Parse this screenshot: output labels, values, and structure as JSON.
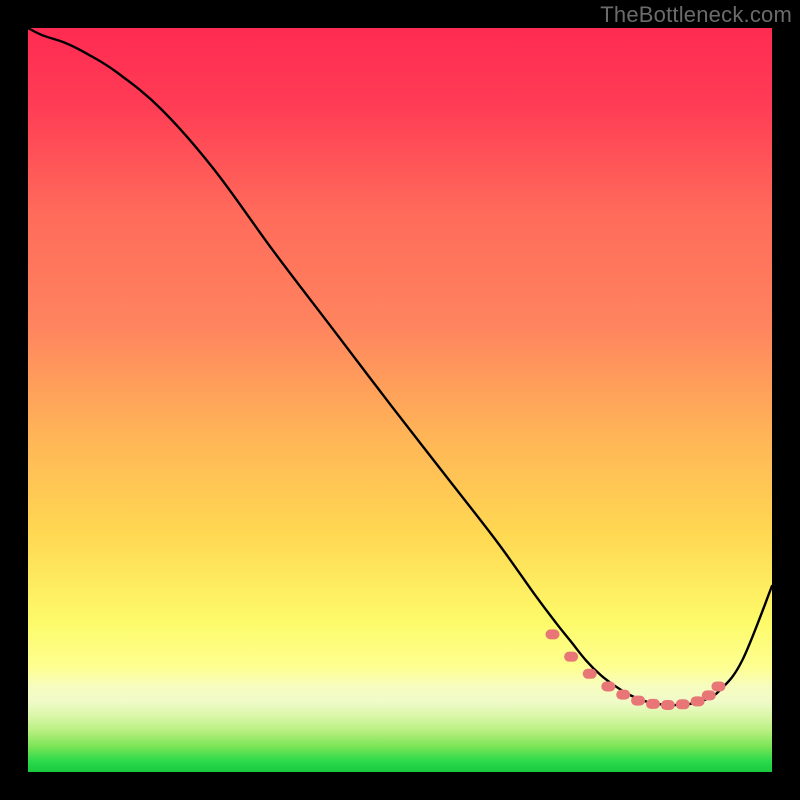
{
  "watermark": "TheBottleneck.com",
  "colors": {
    "frame": "#000000",
    "grad_top": "#ff2b52",
    "grad_mid1": "#ff845f",
    "grad_mid2": "#ffd852",
    "grad_mid3": "#fdfb6a",
    "grad_band": "#f7fcbf",
    "grad_green": "#2dda4b",
    "curve": "#000000",
    "marker": "#e97676"
  },
  "chart_data": {
    "type": "line",
    "title": "",
    "xlabel": "",
    "ylabel": "",
    "xlim": [
      0,
      100
    ],
    "ylim": [
      0,
      100
    ],
    "grid": false,
    "legend": false,
    "series": [
      {
        "name": "bottleneck-curve",
        "x": [
          0,
          2,
          5,
          8,
          12,
          18,
          25,
          33,
          41,
          49,
          56,
          63,
          68,
          71,
          73,
          75,
          77,
          79,
          81,
          83,
          85,
          87,
          89,
          91,
          93,
          96,
          100
        ],
        "y": [
          100,
          99,
          98,
          96.5,
          94,
          89,
          81,
          70,
          59.5,
          49,
          40,
          31,
          24,
          20,
          17.5,
          15,
          13,
          11.5,
          10.3,
          9.5,
          9.1,
          9.0,
          9.15,
          9.7,
          11,
          15,
          25
        ]
      }
    ],
    "markers": {
      "name": "highlight-dots",
      "x": [
        70.5,
        73,
        75.5,
        78,
        80,
        82,
        84,
        86,
        88,
        90,
        91.5,
        92.8
      ],
      "y": [
        18.5,
        15.5,
        13.2,
        11.5,
        10.4,
        9.6,
        9.15,
        9.0,
        9.1,
        9.5,
        10.3,
        11.5
      ]
    },
    "annotations": []
  }
}
